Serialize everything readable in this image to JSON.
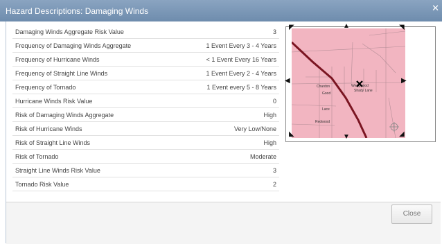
{
  "dialog": {
    "title": "Hazard Descriptions: Damaging Winds"
  },
  "table": {
    "rows": [
      {
        "label": "Damaging Winds Aggregate Risk Value",
        "value": "3"
      },
      {
        "label": "Frequency of Damaging Winds Aggregate",
        "value": "1 Event Every 3 - 4 Years"
      },
      {
        "label": "Frequency of Hurricane Winds",
        "value": "< 1 Event Every 16 Years"
      },
      {
        "label": "Frequency of Straight Line Winds",
        "value": "1 Event Every 2 - 4 Years"
      },
      {
        "label": "Frequency of Tornado",
        "value": "1 Event every 5 - 8 Years"
      },
      {
        "label": "Hurricane Winds Risk Value",
        "value": "0"
      },
      {
        "label": "Risk of Damaging Winds Aggregate",
        "value": "High"
      },
      {
        "label": "Risk of Hurricane Winds",
        "value": "Very Low/None"
      },
      {
        "label": "Risk of Straight Line Winds",
        "value": "High"
      },
      {
        "label": "Risk of Tornado",
        "value": "Moderate"
      },
      {
        "label": "Straight Line Winds Risk Value",
        "value": "3"
      },
      {
        "label": "Tornado Risk Value",
        "value": "2"
      }
    ]
  },
  "map": {
    "fill_color": "#f2b5c1",
    "road_color": "#7b1522",
    "labels": {
      "a": "Wedgwood",
      "b": "Chardon",
      "c": "Shady Lane",
      "d": "Good",
      "e": "Lace",
      "f": "Redwood"
    }
  },
  "footer": {
    "close_label": "Close"
  }
}
